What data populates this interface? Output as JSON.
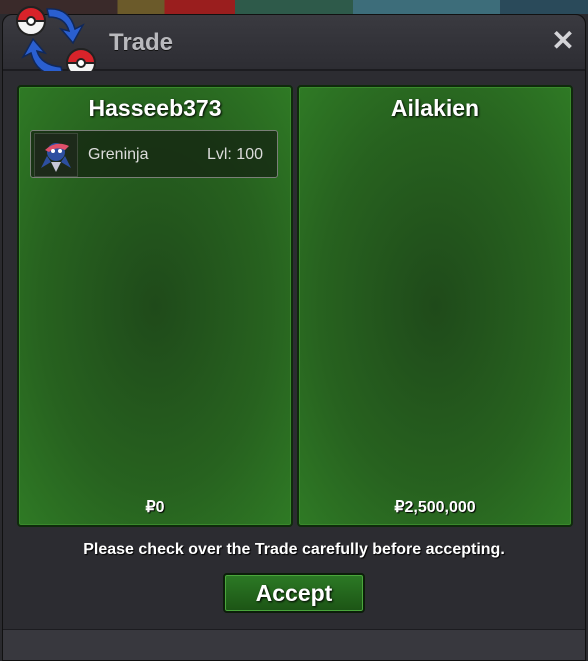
{
  "window": {
    "title": "Trade",
    "close_label": "✕"
  },
  "left_panel": {
    "player": "Hasseeb373",
    "items": [
      {
        "name": "Greninja",
        "level": "Lvl: 100",
        "icon": "greninja-sprite-icon"
      }
    ],
    "money": "₽0"
  },
  "right_panel": {
    "player": "Ailakien",
    "items": [],
    "money": "₽2,500,000"
  },
  "notice": "Please check over the Trade carefully before accepting.",
  "accept_label": "Accept",
  "colors": {
    "panel_green": "#27621f",
    "button_green": "#2c7a25",
    "window_bg": "#2b2b30",
    "title_text": "#b9b9bd"
  }
}
